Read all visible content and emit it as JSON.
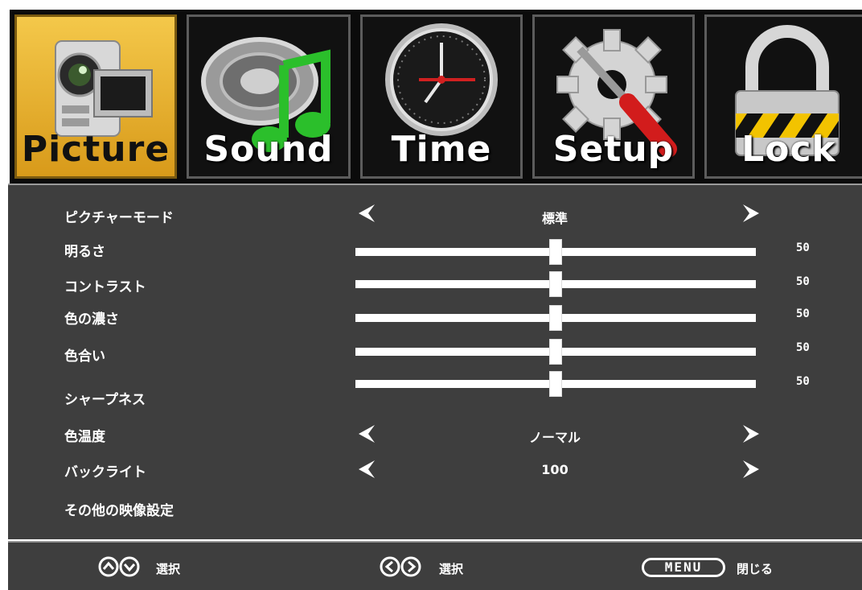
{
  "tabs": [
    {
      "label": "Picture",
      "icon": "camcorder-icon"
    },
    {
      "label": "Sound",
      "icon": "speaker-music-icon"
    },
    {
      "label": "Time",
      "icon": "clock-icon"
    },
    {
      "label": "Setup",
      "icon": "gear-wrench-icon"
    },
    {
      "label": "Lock",
      "icon": "padlock-icon"
    }
  ],
  "active_tab": "Picture",
  "picture_menu": {
    "picture_mode": {
      "label": "ピクチャーモード",
      "value": "標準"
    },
    "brightness": {
      "label": "明るさ",
      "value": "50",
      "level": 0.5
    },
    "contrast": {
      "label": "コントラスト",
      "value": "50",
      "level": 0.5
    },
    "color": {
      "label": "色の濃さ",
      "value": "50",
      "level": 0.5
    },
    "tint": {
      "label": "色合い",
      "value": "50",
      "level": 0.5
    },
    "sharpness": {
      "label": "シャープネス",
      "value": "50",
      "level": 0.5
    },
    "color_temp": {
      "label": "色温度",
      "value": "ノーマル"
    },
    "backlight": {
      "label": "バックライト",
      "value": "100"
    },
    "other_settings": {
      "label": "その他の映像設定"
    }
  },
  "footer": {
    "updown_hint": "選択",
    "leftright_hint": "選択",
    "menu_key": "MENU",
    "menu_hint": "閉じる"
  },
  "colors": {
    "active_tab": "#e8b532",
    "panel_bg": "#3e3e3e",
    "text": "#ffffff"
  }
}
